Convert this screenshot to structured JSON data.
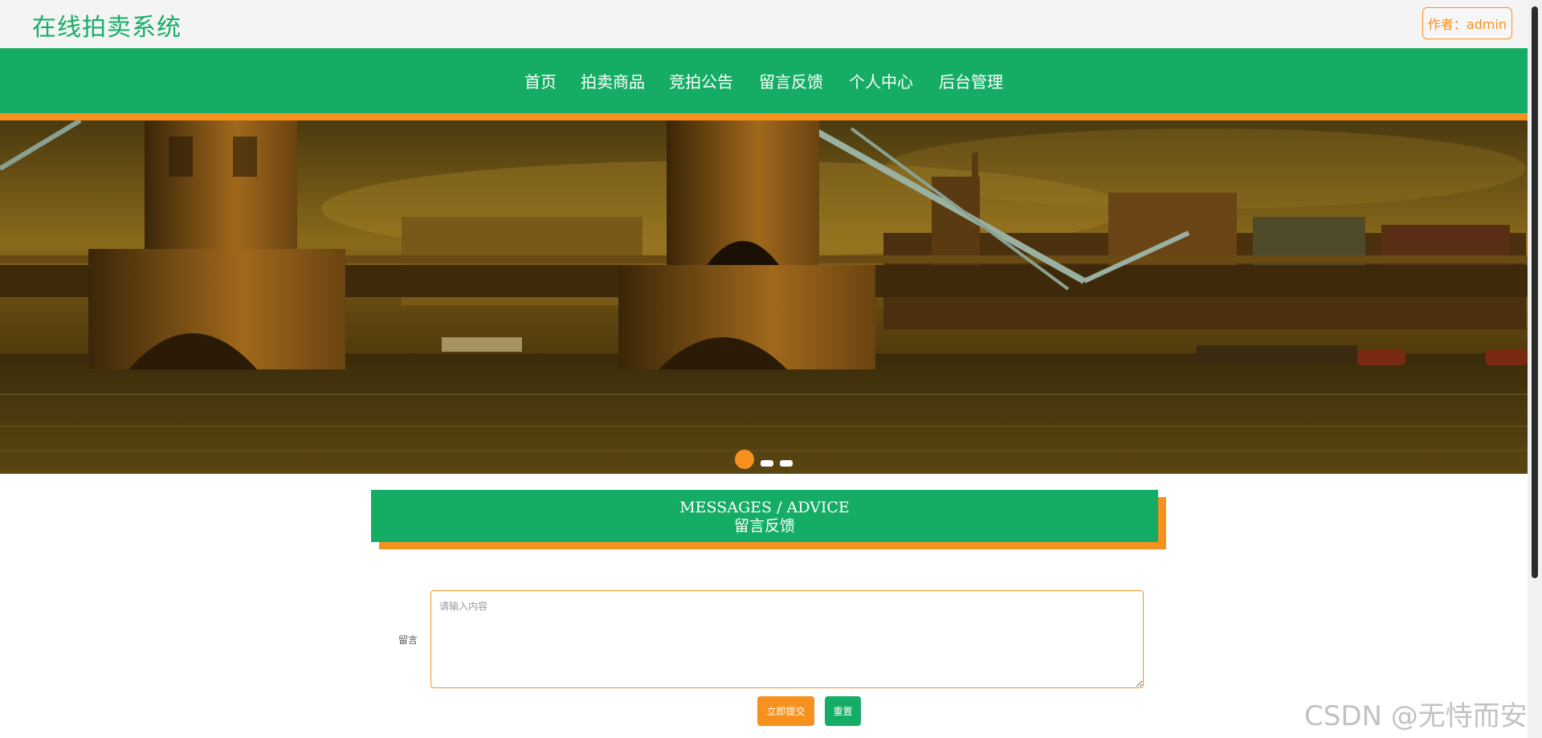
{
  "header": {
    "site_title": "在线拍卖系统",
    "author_label": "作者：admin"
  },
  "nav": {
    "items": [
      {
        "label": "首页"
      },
      {
        "label": "拍卖商品"
      },
      {
        "label": "竞拍公告"
      },
      {
        "label": "留言反馈"
      },
      {
        "label": "个人中心"
      },
      {
        "label": "后台管理"
      }
    ]
  },
  "banner": {
    "slide_count": 3,
    "active_slide": 1
  },
  "section": {
    "title_en": "MESSAGES / ADVICE",
    "title_cn": "留言反馈"
  },
  "form": {
    "message_label": "留言",
    "message_placeholder": "请输入内容",
    "message_value": "",
    "submit_label": "立即提交",
    "reset_label": "重置"
  },
  "watermark": "CSDN @无恃而安",
  "colors": {
    "brand_green": "#15ad65",
    "accent_orange": "#f7911e",
    "topbar_bg": "#f4f4f4"
  }
}
